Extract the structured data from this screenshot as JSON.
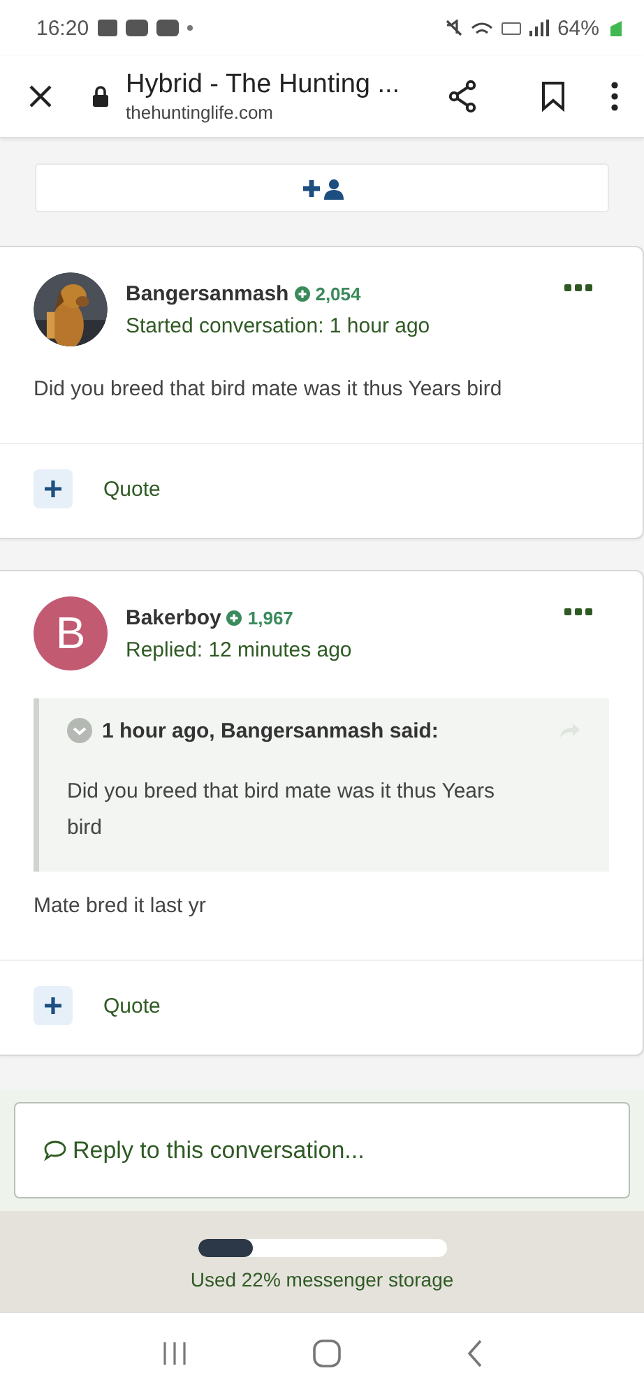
{
  "status_bar": {
    "time": "16:20",
    "battery": "64%"
  },
  "browser": {
    "title": "Hybrid - The Hunting ...",
    "url": "thehuntinglife.com"
  },
  "posts": [
    {
      "author": "Bangersanmash",
      "reputation": "2,054",
      "meta": "Started conversation: 1 hour ago",
      "body": "Did you breed that bird mate was it thus Years bird",
      "action": "Quote"
    },
    {
      "author": "Bakerboy",
      "reputation": "1,967",
      "meta": "Replied: 12 minutes ago",
      "avatar": {
        "kind": "letter",
        "letter": "B",
        "color": "#c25a72"
      },
      "quote": {
        "header": "1 hour ago, Bangersanmash said:",
        "text": "Did you breed that bird mate was it thus Years bird"
      },
      "body": "Mate bred it last yr",
      "action": "Quote"
    }
  ],
  "reply": {
    "placeholder": "Reply to this conversation..."
  },
  "storage": {
    "level": 0.22,
    "label": "Used 22% messenger storage"
  }
}
